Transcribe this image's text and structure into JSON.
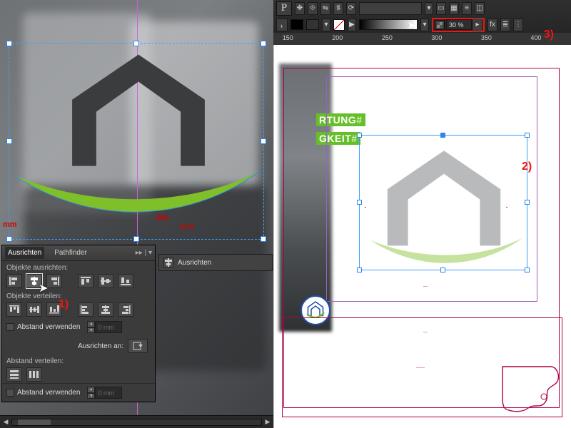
{
  "left_canvas": {
    "measure_mm_left": "mm",
    "measure_value": "396",
    "measure_mm_right": "mm"
  },
  "align_panel": {
    "tabs": {
      "align": "Ausrichten",
      "pathfinder": "Pathfinder",
      "menu_glyph": "▸▸ | ▾"
    },
    "section_align": "Objekte ausrichten:",
    "section_distribute": "Objekte verteilen:",
    "section_align_to": "Ausrichten an:",
    "section_spacing": "Abstand verteilen:",
    "use_spacing": "Abstand verwenden",
    "spacing_value": "0 mm"
  },
  "mini_panel": {
    "label": "Ausrichten"
  },
  "annotations": {
    "one": "1)",
    "two": "2)",
    "three": "3)"
  },
  "control_bar": {
    "opacity_value": "30 %",
    "ruler": [
      "150",
      "200",
      "250",
      "300",
      "350",
      "400"
    ]
  },
  "page": {
    "chip1_text": "RTUNG",
    "chip2_text": "GKEIT",
    "hash": "#"
  },
  "chart_data": null
}
